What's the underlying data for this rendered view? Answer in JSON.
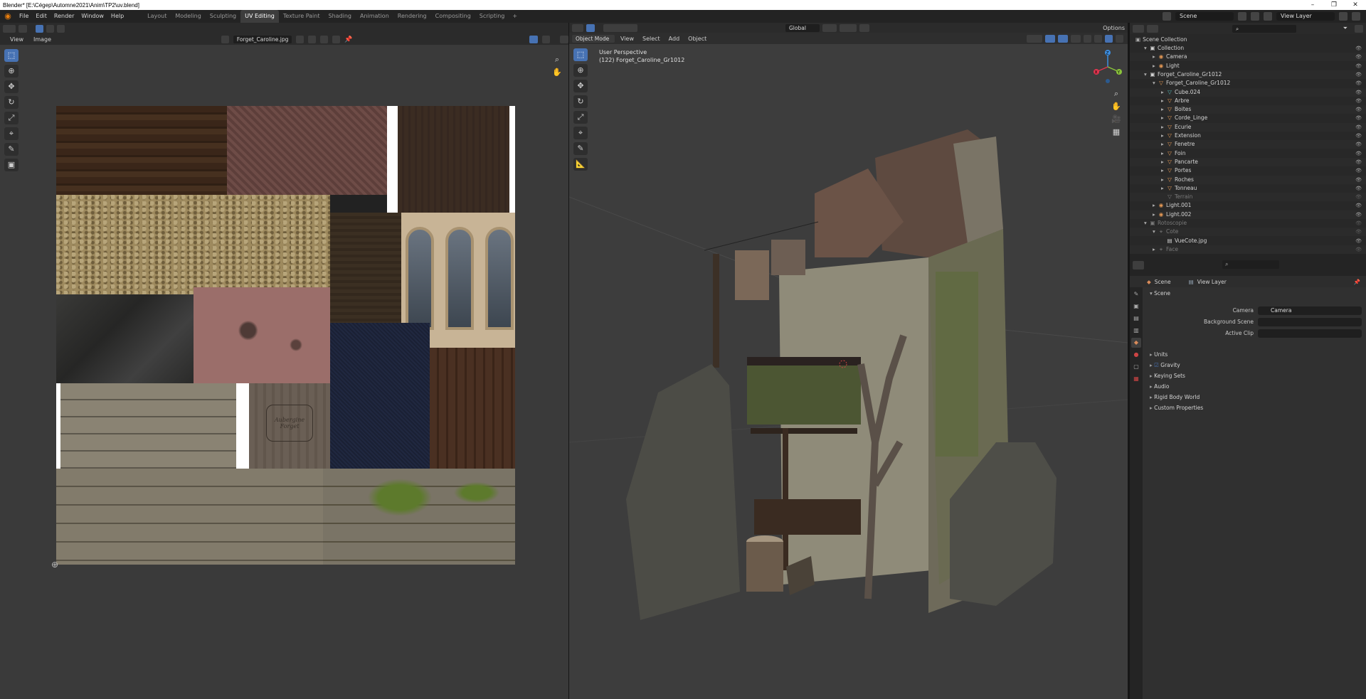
{
  "window": {
    "title": "Blender* [E:\\Cégep\\Automne2021\\Anim\\TP2\\uv.blend]",
    "controls": [
      "–",
      "❐",
      "✕"
    ]
  },
  "menus": [
    "File",
    "Edit",
    "Render",
    "Window",
    "Help"
  ],
  "workspaces": [
    {
      "label": "Layout",
      "active": false
    },
    {
      "label": "Modeling",
      "active": false
    },
    {
      "label": "Sculpting",
      "active": false
    },
    {
      "label": "UV Editing",
      "active": true
    },
    {
      "label": "Texture Paint",
      "active": false
    },
    {
      "label": "Shading",
      "active": false
    },
    {
      "label": "Animation",
      "active": false
    },
    {
      "label": "Rendering",
      "active": false
    },
    {
      "label": "Compositing",
      "active": false
    },
    {
      "label": "Scripting",
      "active": false
    }
  ],
  "topbar_right": {
    "scene": "Scene",
    "view_layer": "View Layer"
  },
  "uv_editor": {
    "menus": [
      "View",
      "Image"
    ],
    "image_name": "Forget_Caroline.jpg",
    "sign_text": "Aubergine Forget"
  },
  "viewport": {
    "mode": "Object Mode",
    "menus": [
      "View",
      "Select",
      "Add",
      "Object"
    ],
    "orientation": "Global",
    "options_label": "Options",
    "perspective_label": "User Perspective",
    "object_label": "(122) Forget_Caroline_Gr1012",
    "gizmo_axes": {
      "x": "X",
      "y": "Y",
      "z": "Z"
    },
    "accent_colors": {
      "x": "#e2354f",
      "y": "#8bc43b",
      "z": "#3d8ee0"
    }
  },
  "outliner": {
    "root": "Scene Collection",
    "rows": [
      {
        "label": "Collection",
        "indent": 1,
        "icon": "collection-icon",
        "icon_char": "▣",
        "color": "#d4d4d4",
        "arrow": "▾",
        "muted": false
      },
      {
        "label": "Camera",
        "indent": 2,
        "icon": "camera-icon",
        "icon_char": "◉",
        "color": "#e89b56",
        "arrow": "▸",
        "muted": false
      },
      {
        "label": "Light",
        "indent": 2,
        "icon": "light-icon",
        "icon_char": "◉",
        "color": "#e89b56",
        "arrow": "▸",
        "muted": false
      },
      {
        "label": "Forget_Caroline_Gr1012",
        "indent": 1,
        "icon": "collection-icon",
        "icon_char": "▣",
        "color": "#d4d4d4",
        "arrow": "▾",
        "muted": false
      },
      {
        "label": "Forget_Caroline_Gr1012",
        "indent": 2,
        "icon": "mesh-icon",
        "icon_char": "▽",
        "color": "#e89b56",
        "arrow": "▾",
        "muted": false
      },
      {
        "label": "Cube.024",
        "indent": 3,
        "icon": "mesh-icon",
        "icon_char": "▽",
        "color": "#55b7b7",
        "arrow": "▸",
        "muted": false
      },
      {
        "label": "Arbre",
        "indent": 3,
        "icon": "mesh-icon",
        "icon_char": "▽",
        "color": "#e89b56",
        "arrow": "▸",
        "muted": false
      },
      {
        "label": "Boites",
        "indent": 3,
        "icon": "mesh-icon",
        "icon_char": "▽",
        "color": "#e89b56",
        "arrow": "▸",
        "muted": false
      },
      {
        "label": "Corde_Linge",
        "indent": 3,
        "icon": "mesh-icon",
        "icon_char": "▽",
        "color": "#e89b56",
        "arrow": "▸",
        "muted": false
      },
      {
        "label": "Ecurie",
        "indent": 3,
        "icon": "mesh-icon",
        "icon_char": "▽",
        "color": "#e89b56",
        "arrow": "▸",
        "muted": false
      },
      {
        "label": "Extension",
        "indent": 3,
        "icon": "mesh-icon",
        "icon_char": "▽",
        "color": "#e89b56",
        "arrow": "▸",
        "muted": false
      },
      {
        "label": "Fenetre",
        "indent": 3,
        "icon": "mesh-icon",
        "icon_char": "▽",
        "color": "#e89b56",
        "arrow": "▸",
        "muted": false
      },
      {
        "label": "Foin",
        "indent": 3,
        "icon": "mesh-icon",
        "icon_char": "▽",
        "color": "#e89b56",
        "arrow": "▸",
        "muted": false
      },
      {
        "label": "Pancarte",
        "indent": 3,
        "icon": "mesh-icon",
        "icon_char": "▽",
        "color": "#e89b56",
        "arrow": "▸",
        "muted": false
      },
      {
        "label": "Portes",
        "indent": 3,
        "icon": "mesh-icon",
        "icon_char": "▽",
        "color": "#e89b56",
        "arrow": "▸",
        "muted": false
      },
      {
        "label": "Roches",
        "indent": 3,
        "icon": "mesh-icon",
        "icon_char": "▽",
        "color": "#e89b56",
        "arrow": "▸",
        "muted": false
      },
      {
        "label": "Tonneau",
        "indent": 3,
        "icon": "mesh-icon",
        "icon_char": "▽",
        "color": "#e89b56",
        "arrow": "▸",
        "muted": false
      },
      {
        "label": "Terrain",
        "indent": 3,
        "icon": "mesh-icon",
        "icon_char": "▽",
        "color": "#7a7a7a",
        "arrow": "",
        "muted": true
      },
      {
        "label": "Light.001",
        "indent": 2,
        "icon": "light-icon",
        "icon_char": "◉",
        "color": "#e89b56",
        "arrow": "▸",
        "muted": false
      },
      {
        "label": "Light.002",
        "indent": 2,
        "icon": "light-icon",
        "icon_char": "◉",
        "color": "#e89b56",
        "arrow": "▸",
        "muted": false
      },
      {
        "label": "Rotoscopie",
        "indent": 1,
        "icon": "collection-icon",
        "icon_char": "▣",
        "color": "#7a7a7a",
        "arrow": "▾",
        "muted": true
      },
      {
        "label": "Cote",
        "indent": 2,
        "icon": "empty-icon",
        "icon_char": "⌖",
        "color": "#7a7a7a",
        "arrow": "▾",
        "muted": true
      },
      {
        "label": "VueCote.jpg",
        "indent": 3,
        "icon": "image-icon",
        "icon_char": "▤",
        "color": "#d4d4d4",
        "arrow": "",
        "muted": false
      },
      {
        "label": "Face",
        "indent": 2,
        "icon": "empty-icon",
        "icon_char": "⌖",
        "color": "#7a7a7a",
        "arrow": "▸",
        "muted": true
      }
    ]
  },
  "properties": {
    "breadcrumb_scene": "Scene",
    "breadcrumb_layer": "View Layer",
    "panel_title": "Scene",
    "fields": [
      {
        "label": "Camera",
        "value": "Camera"
      },
      {
        "label": "Background Scene",
        "value": ""
      },
      {
        "label": "Active Clip",
        "value": ""
      }
    ],
    "sections": [
      {
        "label": "Units",
        "checkbox": false
      },
      {
        "label": "Gravity",
        "checkbox": true
      },
      {
        "label": "Keying Sets",
        "checkbox": false
      },
      {
        "label": "Audio",
        "checkbox": false
      },
      {
        "label": "Rigid Body World",
        "checkbox": false
      },
      {
        "label": "Custom Properties",
        "checkbox": false
      }
    ]
  }
}
